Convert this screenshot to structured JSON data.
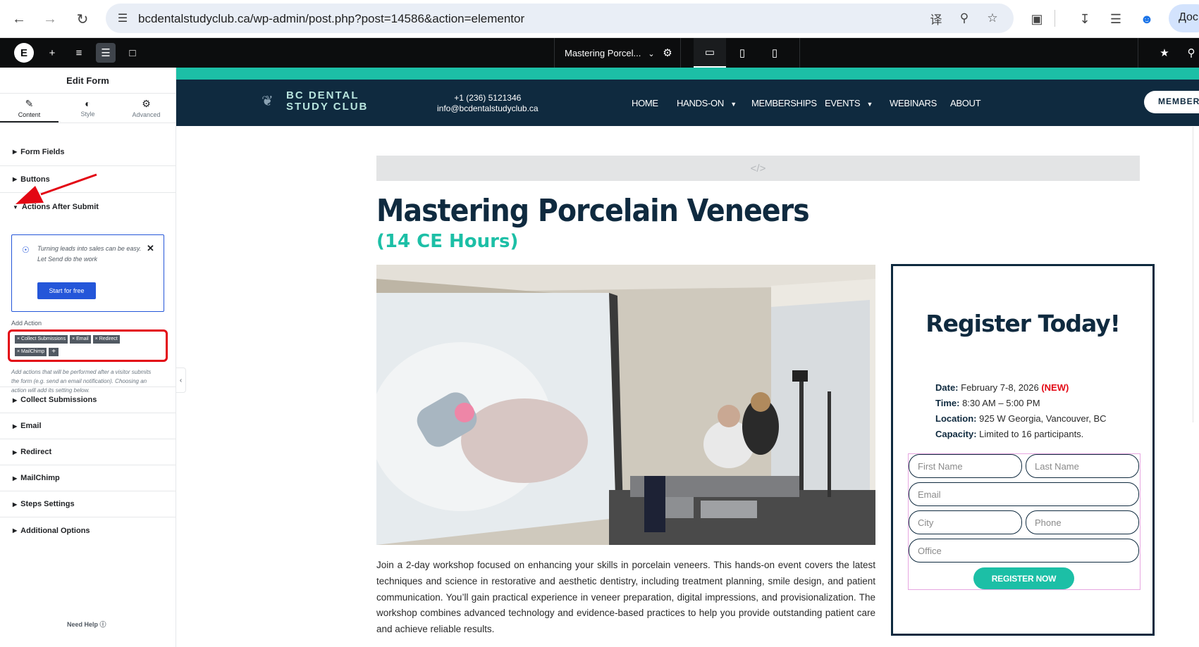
{
  "browser": {
    "url": "bcdentalstudyclub.ca/wp-admin/post.php?post=14586&action=elementor",
    "profile_label": "Дос"
  },
  "editor_bar": {
    "page_name": "Mastering Porcel..."
  },
  "panel": {
    "title": "Edit Form",
    "tabs": [
      {
        "label": "Content"
      },
      {
        "label": "Style"
      },
      {
        "label": "Advanced"
      }
    ],
    "sections_top": [
      "Form Fields",
      "Buttons",
      "Actions After Submit"
    ],
    "promo": {
      "text_line1": "Turning leads into sales can be easy.",
      "text_line2": "Let Send do the work",
      "button": "Start for free"
    },
    "add_action_label": "Add Action",
    "actions": [
      "Collect Submissions",
      "Email",
      "Redirect",
      "MailChimp"
    ],
    "help_text": "Add actions that will be performed after a visitor submits the form (e.g. send an email notification). Choosing an action will add its setting below.",
    "sections_bottom": [
      "Collect Submissions",
      "Email",
      "Redirect",
      "MailChimp",
      "Steps Settings",
      "Additional Options"
    ],
    "need_help": "Need Help"
  },
  "site": {
    "logo_line1": "BC DENTAL",
    "logo_line2": "STUDY CLUB",
    "phone": "+1 (236) 5121346",
    "email": "info@bcdentalstudyclub.ca",
    "menu": [
      "HOME",
      "HANDS-ON",
      "MEMBERSHIPS",
      "EVENTS",
      "WEBINARS",
      "ABOUT"
    ],
    "member_button": "MEMBER",
    "title": "Mastering Porcelain Veneers",
    "subtitle": "(14 CE Hours)",
    "description": "Join a 2-day workshop focused on enhancing your skills in porcelain veneers. This hands-on event covers the latest techniques and science in restorative and aesthetic dentistry, including treatment planning, smile design, and patient communication. You’ll gain practical experience in veneer preparation, digital impressions, and provisionalization. The workshop combines advanced technology and evidence-based practices to help you provide outstanding patient care and achieve reliable results."
  },
  "register": {
    "title": "Register Today!",
    "date_label": "Date:",
    "date_value": "February 7-8, 2026",
    "date_badge": "(NEW)",
    "time_label": "Time:",
    "time_value": "8:30 AM – 5:00 PM",
    "location_label": "Location:",
    "location_value": "925 W Georgia, Vancouver, BC",
    "capacity_label": "Capacity:",
    "capacity_value": "Limited to 16 participants.",
    "fields": {
      "first_name": "First Name",
      "last_name": "Last Name",
      "email": "Email",
      "city": "City",
      "phone": "Phone",
      "office": "Office"
    },
    "button": "REGISTER NOW"
  },
  "colors": {
    "teal": "#1cbfa6",
    "navy": "#0f2a3f",
    "annotation_red": "#e30613",
    "elementor_blue": "#2456d9"
  }
}
